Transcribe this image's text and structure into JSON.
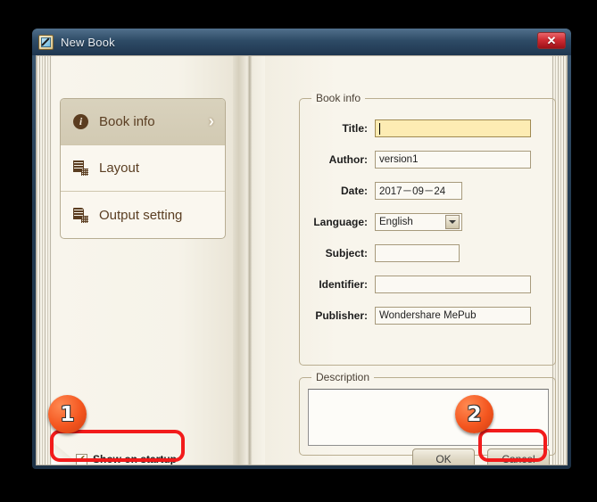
{
  "window": {
    "title": "New Book",
    "app_icon": "pen-document-icon",
    "close_label": "✕"
  },
  "sidebar": {
    "items": [
      {
        "label": "Book info",
        "icon": "info-icon",
        "active": true,
        "chevron": "›"
      },
      {
        "label": "Layout",
        "icon": "layout-document-icon",
        "active": false
      },
      {
        "label": "Output setting",
        "icon": "output-folder-icon",
        "active": false
      }
    ]
  },
  "book_info": {
    "group_title": "Book info",
    "fields": [
      {
        "label": "Title:",
        "value": "",
        "type": "text",
        "highlight": true
      },
      {
        "label": "Author:",
        "value": "version1",
        "type": "text"
      },
      {
        "label": "Date:",
        "value": "2017－09－24",
        "type": "text"
      },
      {
        "label": "Language:",
        "value": "English",
        "type": "select"
      },
      {
        "label": "Subject:",
        "value": "",
        "type": "text"
      },
      {
        "label": "Identifier:",
        "value": "",
        "type": "text"
      },
      {
        "label": "Publisher:",
        "value": "Wondershare MePub",
        "type": "text"
      }
    ]
  },
  "description": {
    "group_title": "Description",
    "value": ""
  },
  "footer": {
    "show_on_startup": {
      "label": "Show on startup",
      "checked": true,
      "tick": "✔"
    },
    "ok_label": "OK",
    "cancel_label": "Cancel"
  },
  "annotations": {
    "badges": [
      {
        "number": "1",
        "target": "show-on-startup-checkbox"
      },
      {
        "number": "2",
        "target": "cancel-button"
      }
    ],
    "highlight_color": "#f21b1b"
  },
  "colors": {
    "titlebar": "#2e4b66",
    "page": "#f8f5ec",
    "accent_brown": "#5b3d20",
    "highlight_field": "#fdecb3",
    "badge_orange": "#f4561f",
    "close_red": "#cf2c33"
  }
}
